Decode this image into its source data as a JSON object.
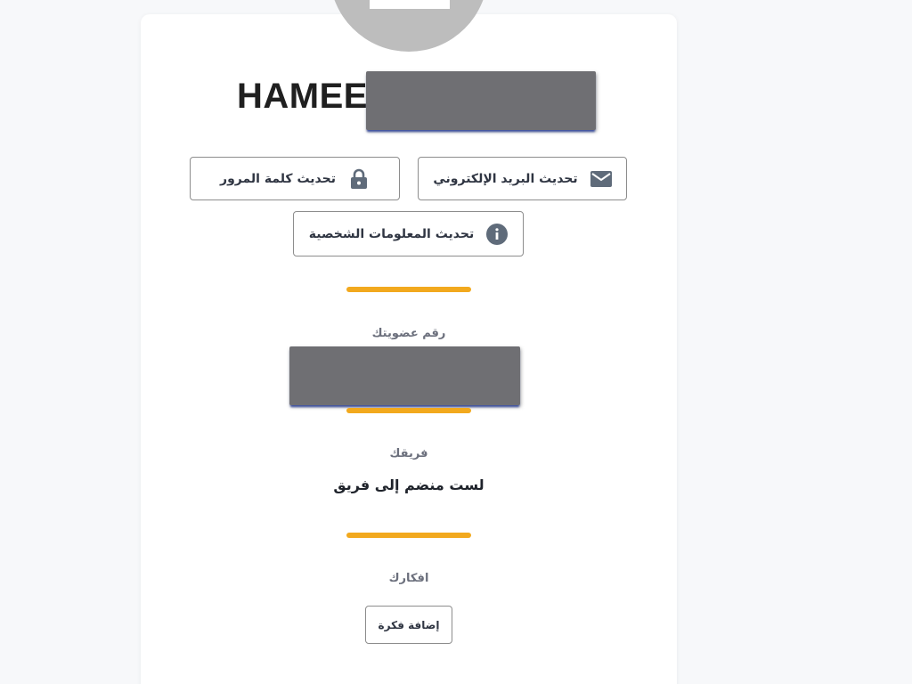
{
  "profile": {
    "name_visible": "HAMEE",
    "name_redacted": true
  },
  "actions": {
    "update_email": {
      "label": "تحديث البريد الإلكتروني",
      "icon": "mail-icon"
    },
    "update_password": {
      "label": "تحديث كلمة المرور",
      "icon": "lock-icon"
    },
    "update_personal_info": {
      "label": "تحديث المعلومات الشخصية",
      "icon": "info-icon"
    }
  },
  "membership": {
    "label": "رقم عضويتك",
    "value_redacted": true
  },
  "team": {
    "label": "فريقك",
    "value": "لست منضم إلى فريق"
  },
  "ideas": {
    "label": "افكارك",
    "add_button": "إضافة فكرة"
  },
  "colors": {
    "accent": "#f2a91e",
    "avatar": "#bdbdbd",
    "redaction": "#6f6f73",
    "text_dark": "#1f232b",
    "text_muted": "#6b6f7c",
    "background": "#f7f8fa"
  }
}
